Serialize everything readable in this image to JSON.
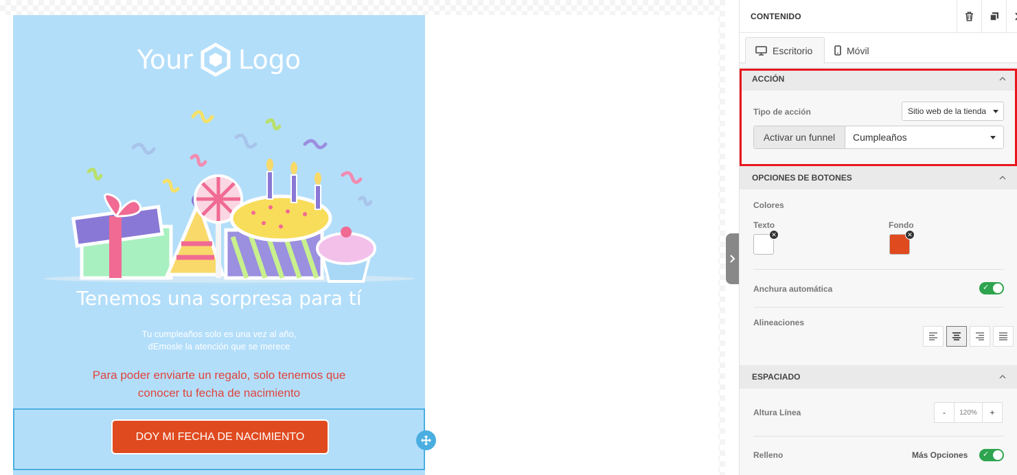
{
  "email": {
    "logo_text_left": "Your",
    "logo_text_right": "Logo",
    "headline": "Tenemos una sorpresa para tí",
    "subtext_line1": "Tu cumpleaños solo es una vez al año,",
    "subtext_line2": "dEmosle la atención que se merece",
    "red_line1": "Para poder enviarte un regalo, solo tenemos que",
    "red_line2": "conocer tu fecha de nacimiento",
    "cta_label": "DOY MI FECHA DE NACIMIENTO",
    "background_color": "#b3defa",
    "cta_color": "#e04a1f"
  },
  "panel": {
    "title": "CONTENIDO",
    "header_icons": [
      "trash-icon",
      "duplicate-icon",
      "close-icon"
    ],
    "tabs": [
      {
        "label": "Escritorio",
        "icon": "desktop-icon",
        "active": true
      },
      {
        "label": "Móvil",
        "icon": "mobile-icon",
        "active": false
      }
    ],
    "action": {
      "section_title": "ACCIÓN",
      "type_label": "Tipo de acción",
      "type_value": "Sitio web de la tienda",
      "funnel_addon": "Activar un funnel",
      "funnel_value": "Cumpleaños",
      "highlight_color": "#e8141d"
    },
    "button_options": {
      "section_title": "OPCIONES DE BOTONES",
      "colors_label": "Colores",
      "text_color_label": "Texto",
      "background_color_label": "Fondo",
      "text_color": "#ffffff",
      "background_color": "#e04a1f",
      "auto_width_label": "Anchura automática",
      "auto_width_on": true,
      "alignments_label": "Alineaciones",
      "alignments": [
        "align-left-icon",
        "align-center-icon",
        "align-right-icon",
        "align-justify-icon"
      ],
      "active_alignment": "align-center-icon"
    },
    "spacing": {
      "section_title": "ESPACIADO",
      "line_height_label": "Altura Línea",
      "line_height_minus": "-",
      "line_height_value": "120%",
      "line_height_plus": "+",
      "padding_label": "Relleno",
      "more_options_label": "Más Opciones",
      "more_options_on": true
    }
  }
}
